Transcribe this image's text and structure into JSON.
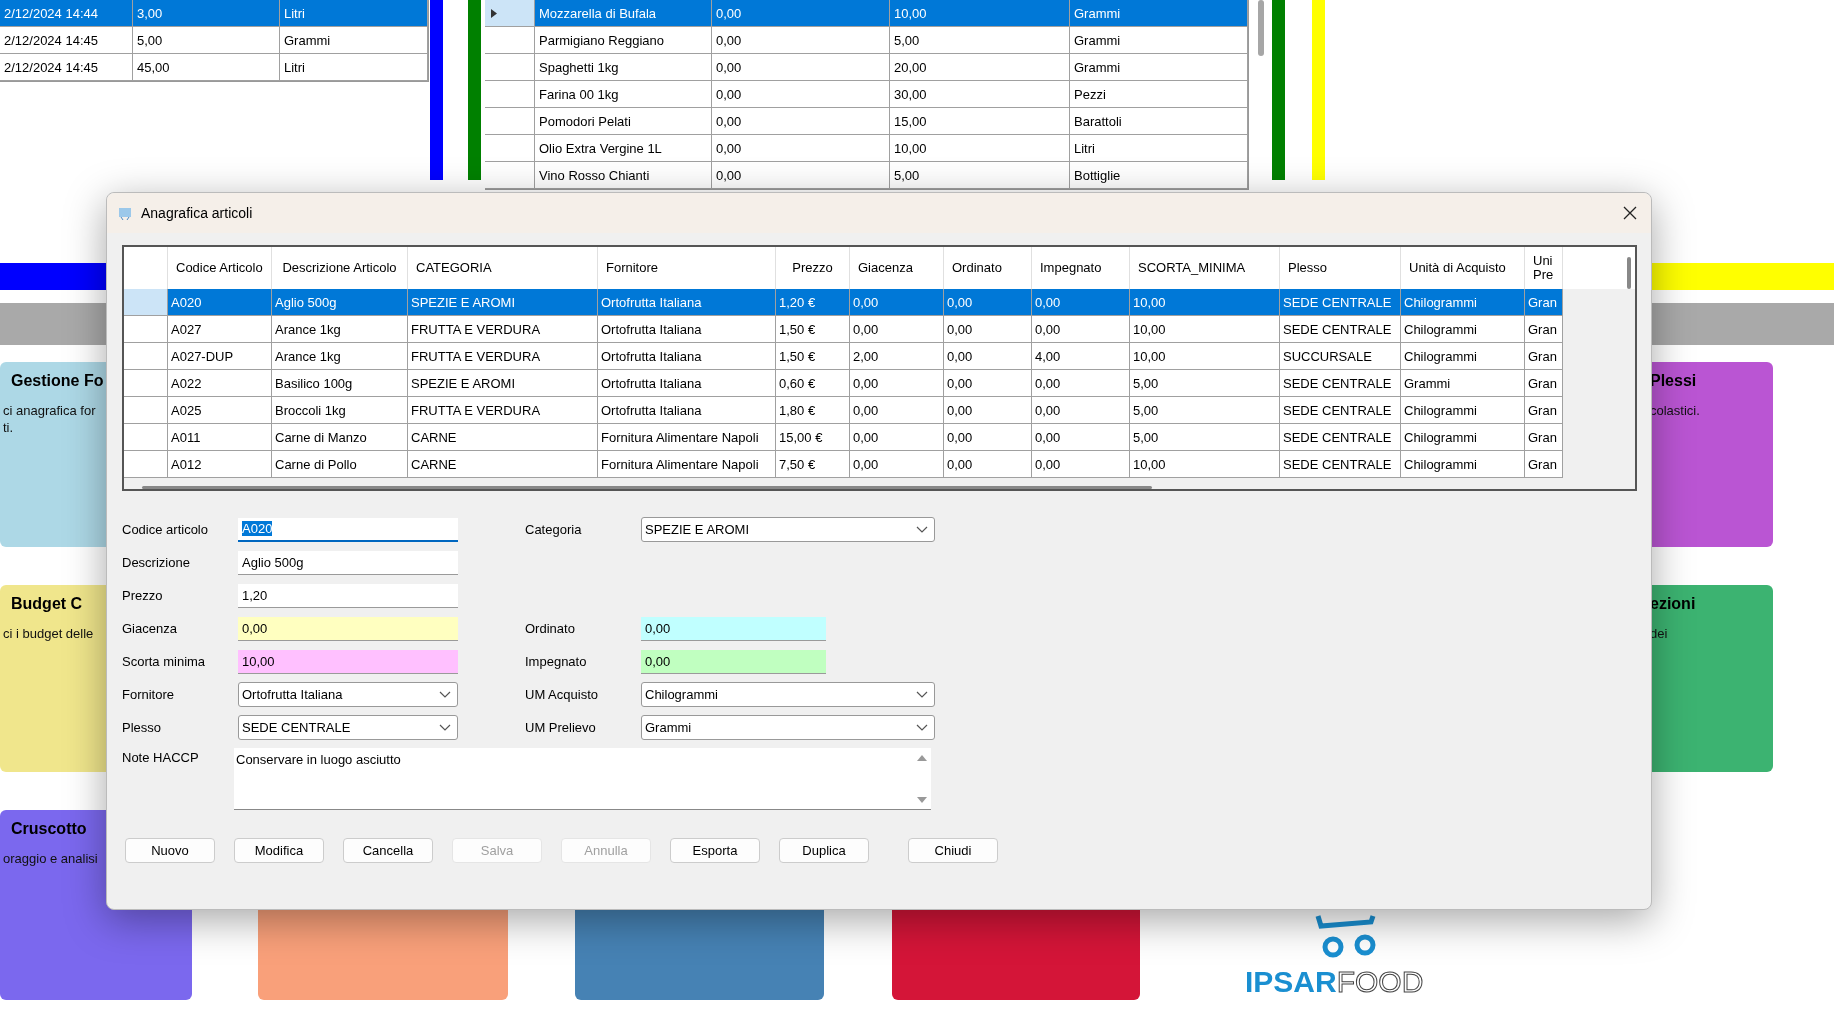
{
  "background": {
    "left_grid": {
      "rows": [
        {
          "selected": true,
          "cells": [
            "2/12/2024 14:44",
            "3,00",
            "Litri"
          ]
        },
        {
          "selected": false,
          "cells": [
            "2/12/2024 14:45",
            "5,00",
            "Grammi"
          ]
        },
        {
          "selected": false,
          "cells": [
            "2/12/2024 14:45",
            "45,00",
            "Litri"
          ]
        }
      ]
    },
    "middle_grid": {
      "rows": [
        {
          "selected": true,
          "cells": [
            "Mozzarella di Bufala",
            "0,00",
            "10,00",
            "Grammi"
          ]
        },
        {
          "selected": false,
          "cells": [
            "Parmigiano Reggiano",
            "0,00",
            "5,00",
            "Grammi"
          ]
        },
        {
          "selected": false,
          "cells": [
            "Spaghetti 1kg",
            "0,00",
            "20,00",
            "Grammi"
          ]
        },
        {
          "selected": false,
          "cells": [
            "Farina 00 1kg",
            "0,00",
            "30,00",
            "Pezzi"
          ]
        },
        {
          "selected": false,
          "cells": [
            "Pomodori Pelati",
            "0,00",
            "15,00",
            "Barattoli"
          ]
        },
        {
          "selected": false,
          "cells": [
            "Olio Extra Vergine 1L",
            "0,00",
            "10,00",
            "Litri"
          ]
        },
        {
          "selected": false,
          "cells": [
            "Vino Rosso Chianti",
            "0,00",
            "5,00",
            "Bottiglie"
          ]
        }
      ]
    },
    "cards": [
      {
        "title": "Gestione Fo",
        "text": "ci anagrafica for",
        "text_2": "ti.",
        "color": "#add8e6"
      },
      {
        "title": "Budget C",
        "text": "ci i budget delle",
        "color": "#f0e68c"
      },
      {
        "title": "Cruscotto",
        "text": "oraggio e analisi",
        "color": "#7b68ee"
      },
      {
        "title": "Plessi",
        "text": "colastici.",
        "color": "#ba55d3"
      },
      {
        "title": "ezioni",
        "text": "dei",
        "color": "#3cb371"
      },
      {
        "color": "#f9a07a"
      },
      {
        "color": "#4682b4"
      },
      {
        "color": "#d41538"
      }
    ],
    "logo": {
      "strong": "IPSAR",
      "light": "FOOD"
    }
  },
  "dialog": {
    "title": "Anagrafica articoli",
    "table": {
      "columns": [
        "Codice Articolo",
        "Descrizione Articolo",
        "CATEGORIA",
        "Fornitore",
        "Prezzo",
        "Giacenza",
        "Ordinato",
        "Impegnato",
        "SCORTA_MINIMA",
        "Plesso",
        "Unità di Acquisto",
        "Uni Pre"
      ],
      "rows": [
        {
          "selected": true,
          "cells": [
            "A020",
            "Aglio 500g",
            "SPEZIE E AROMI",
            "Ortofrutta Italiana",
            "1,20 €",
            "0,00",
            "0,00",
            "0,00",
            "10,00",
            "SEDE CENTRALE",
            "Chilogrammi",
            "Gran"
          ]
        },
        {
          "selected": false,
          "cells": [
            "A027",
            "Arance 1kg",
            "FRUTTA E VERDURA",
            "Ortofrutta Italiana",
            "1,50 €",
            "0,00",
            "0,00",
            "0,00",
            "10,00",
            "SEDE CENTRALE",
            "Chilogrammi",
            "Gran"
          ]
        },
        {
          "selected": false,
          "cells": [
            "A027-DUP",
            "Arance 1kg",
            "FRUTTA E VERDURA",
            "Ortofrutta Italiana",
            "1,50 €",
            "2,00",
            "0,00",
            "4,00",
            "10,00",
            "SUCCURSALE",
            "Chilogrammi",
            "Gran"
          ]
        },
        {
          "selected": false,
          "cells": [
            "A022",
            "Basilico 100g",
            "SPEZIE E AROMI",
            "Ortofrutta Italiana",
            "0,60 €",
            "0,00",
            "0,00",
            "0,00",
            "5,00",
            "SEDE CENTRALE",
            "Grammi",
            "Gran"
          ]
        },
        {
          "selected": false,
          "cells": [
            "A025",
            "Broccoli 1kg",
            "FRUTTA E VERDURA",
            "Ortofrutta Italiana",
            "1,80 €",
            "0,00",
            "0,00",
            "0,00",
            "5,00",
            "SEDE CENTRALE",
            "Chilogrammi",
            "Gran"
          ]
        },
        {
          "selected": false,
          "cells": [
            "A011",
            "Carne di Manzo",
            "CARNE",
            "Fornitura Alimentare Napoli",
            "15,00 €",
            "0,00",
            "0,00",
            "0,00",
            "5,00",
            "SEDE CENTRALE",
            "Chilogrammi",
            "Gran"
          ]
        },
        {
          "selected": false,
          "cells": [
            "A012",
            "Carne di Pollo",
            "CARNE",
            "Fornitura Alimentare Napoli",
            "7,50 €",
            "0,00",
            "0,00",
            "0,00",
            "10,00",
            "SEDE CENTRALE",
            "Chilogrammi",
            "Gran"
          ]
        }
      ]
    },
    "form_rows": [
      {
        "left": {
          "label": "Codice articolo",
          "kind": "text",
          "value": "A020",
          "focused": true
        },
        "right": {
          "label": "Categoria",
          "kind": "dropdown",
          "value": "SPEZIE E AROMI",
          "focused": false
        }
      },
      {
        "left": {
          "label": "Descrizione",
          "kind": "text",
          "value": "Aglio 500g",
          "focused": false
        }
      },
      {
        "left": {
          "label": "Prezzo",
          "kind": "text",
          "value": "1,20",
          "focused": false
        }
      },
      {
        "left": {
          "label": "Giacenza",
          "kind": "text",
          "value": "0,00",
          "focused": false,
          "color": "#ffffc0"
        },
        "right": {
          "label": "Ordinato",
          "kind": "text",
          "value": "0,00",
          "focused": false,
          "color": "#c0ffff"
        }
      },
      {
        "left": {
          "label": "Scorta minima",
          "kind": "text",
          "value": "10,00",
          "focused": false,
          "color": "#ffc0ff"
        },
        "right": {
          "label": "Impegnato",
          "kind": "text",
          "value": "0,00",
          "focused": false,
          "color": "#c0ffc0"
        }
      },
      {
        "left": {
          "label": "Fornitore",
          "kind": "dropdown",
          "value": "Ortofrutta Italiana",
          "focused": false
        },
        "right": {
          "label": "UM Acquisto",
          "kind": "dropdown",
          "value": "Chilogrammi",
          "focused": false
        }
      },
      {
        "left": {
          "label": "Plesso",
          "kind": "dropdown",
          "value": "SEDE CENTRALE",
          "focused": false
        },
        "right": {
          "label": "UM Prelievo",
          "kind": "dropdown",
          "value": "Grammi",
          "focused": false
        }
      }
    ],
    "note": {
      "label": "Note HACCP",
      "value": "Conservare in luogo asciutto"
    },
    "buttons": [
      {
        "label": "Nuovo",
        "disabled": false
      },
      {
        "label": "Modifica",
        "disabled": false
      },
      {
        "label": "Cancella",
        "disabled": false
      },
      {
        "label": "Salva",
        "disabled": true
      },
      {
        "label": "Annulla",
        "disabled": true
      },
      {
        "label": "Esporta",
        "disabled": false
      },
      {
        "label": "Duplica",
        "disabled": false
      },
      {
        "label": "Chiudi",
        "disabled": false
      }
    ]
  }
}
